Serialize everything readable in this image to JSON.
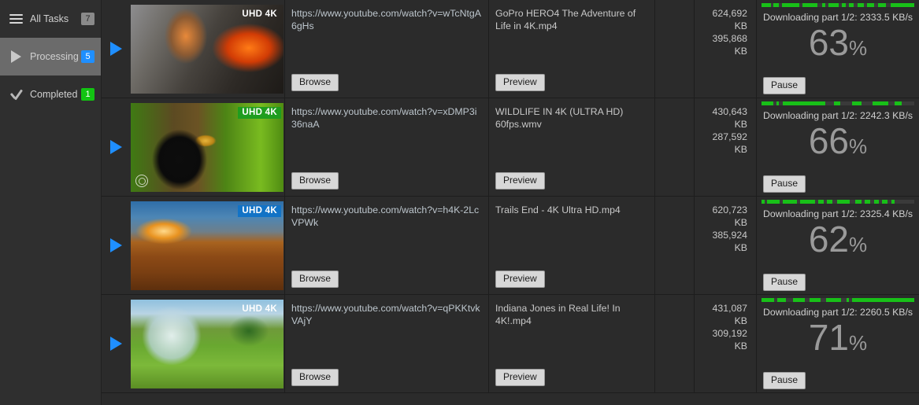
{
  "sidebar": {
    "items": [
      {
        "label": "All Tasks",
        "count": "7",
        "icon": "hamburger-icon",
        "badge_color": "#8a8a8a",
        "active": false
      },
      {
        "label": "Processing",
        "count": "5",
        "icon": "play-icon",
        "badge_color": "#1f8fff",
        "active": true
      },
      {
        "label": "Completed",
        "count": "1",
        "icon": "check-icon",
        "badge_color": "#12c412",
        "active": false
      }
    ]
  },
  "labels": {
    "browse": "Browse",
    "preview": "Preview",
    "pause": "Pause",
    "quality_badge": "UHD 4K"
  },
  "colors": {
    "accent_blue": "#1f8fff",
    "progress_green": "#18c018",
    "badge_green": "#12c412",
    "window_bg": "#2b2b2b",
    "sidebar_bg": "#2f2f2f"
  },
  "tasks": [
    {
      "url": "https://www.youtube.com/watch?v=wTcNtgA6gHs",
      "filename": "GoPro HERO4  The Adventure of Life in 4K.mp4",
      "size_total": "624,692 KB",
      "size_done": "395,868 KB",
      "status": "Downloading part 1/2: 2333.5 KB/s",
      "percent": "63",
      "percent_symbol": "%",
      "quality": "UHD 4K",
      "badge_bg": "transparent",
      "thumb": "volcano-lava-worker",
      "segments": [
        [
          0,
          9
        ],
        [
          11,
          5
        ],
        [
          19,
          16
        ],
        [
          38,
          14
        ],
        [
          56,
          3
        ],
        [
          62,
          10
        ],
        [
          75,
          3
        ],
        [
          81,
          5
        ],
        [
          89,
          6
        ],
        [
          98,
          7
        ],
        [
          108,
          8
        ],
        [
          120,
          22
        ]
      ]
    },
    {
      "url": "https://www.youtube.com/watch?v=xDMP3i36naA",
      "filename": "WILDLIFE IN 4K (ULTRA HD) 60fps.wmv",
      "size_total": "430,643 KB",
      "size_done": "287,592 KB",
      "status": "Downloading part 1/2: 2242.3 KB/s",
      "percent": "66",
      "percent_symbol": "%",
      "quality": "UHD 4K",
      "badge_bg": "#1f9d1f",
      "thumb": "hornbill-bird-jungle",
      "segments": [
        [
          0,
          11
        ],
        [
          14,
          2
        ],
        [
          20,
          39
        ],
        [
          67,
          6
        ],
        [
          84,
          9
        ],
        [
          103,
          15
        ],
        [
          124,
          6
        ]
      ]
    },
    {
      "url": "https://www.youtube.com/watch?v=h4K-2LcVPWk",
      "filename": "Trails End - 4K Ultra HD.mp4",
      "size_total": "620,723 KB",
      "size_done": "385,924 KB",
      "status": "Downloading part 1/2: 2325.4 KB/s",
      "percent": "62",
      "percent_symbol": "%",
      "quality": "UHD 4K",
      "badge_bg": "#1273c6",
      "thumb": "canyon-sunset",
      "segments": [
        [
          0,
          3
        ],
        [
          5,
          12
        ],
        [
          20,
          13
        ],
        [
          36,
          14
        ],
        [
          53,
          5
        ],
        [
          61,
          5
        ],
        [
          70,
          12
        ],
        [
          87,
          6
        ],
        [
          96,
          5
        ],
        [
          105,
          4
        ],
        [
          112,
          5
        ],
        [
          121,
          3
        ]
      ]
    },
    {
      "url": "https://www.youtube.com/watch?v=qPKKtvkVAjY",
      "filename": "Indiana Jones in Real Life! In 4K!.mp4",
      "size_total": "431,087 KB",
      "size_done": "309,192 KB",
      "status": "Downloading part 1/2: 2260.5 KB/s",
      "percent": "71",
      "percent_symbol": "%",
      "quality": "UHD 4K",
      "badge_bg": "transparent",
      "thumb": "zorb-ball-hill-runners",
      "segments": [
        [
          0,
          12
        ],
        [
          15,
          8
        ],
        [
          29,
          11
        ],
        [
          45,
          10
        ],
        [
          60,
          14
        ],
        [
          79,
          2
        ],
        [
          84,
          58
        ]
      ]
    }
  ]
}
